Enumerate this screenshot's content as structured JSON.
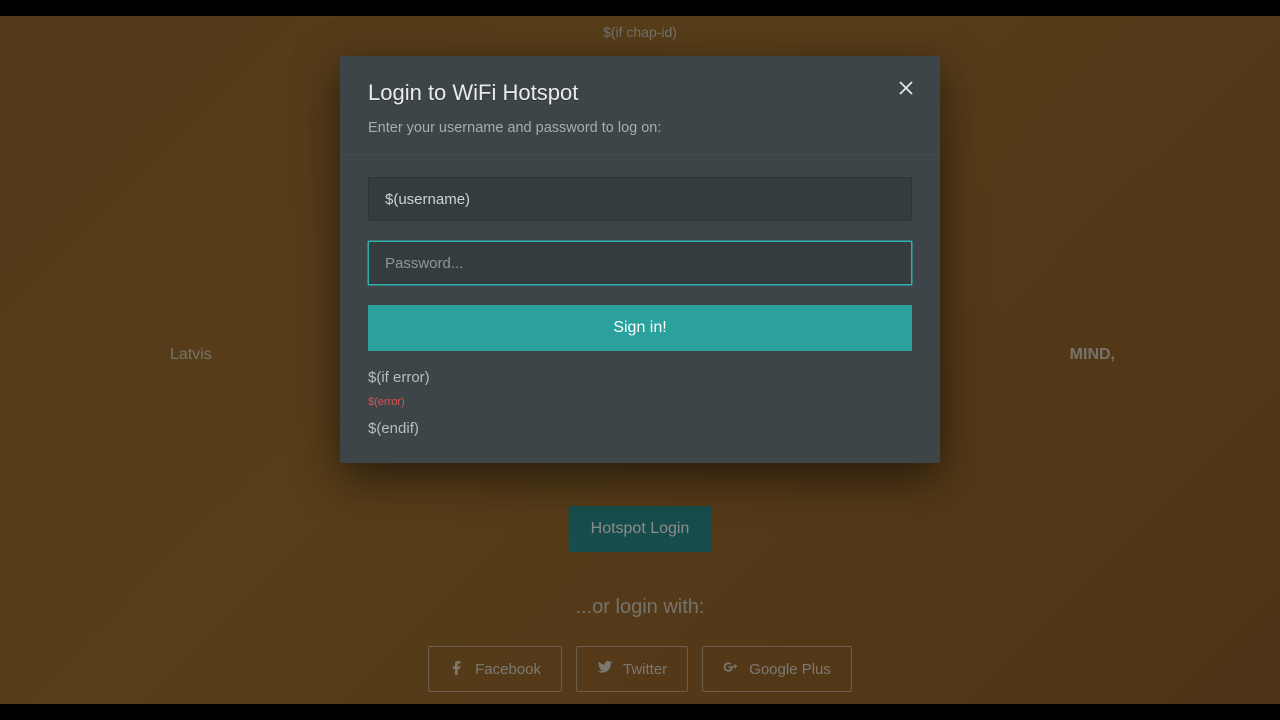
{
  "background": {
    "chap_id": "$(if chap-id)",
    "mid_left": "Latvis",
    "mid_right": "MIND,",
    "hotspot_button": "Hotspot Login",
    "or_login": "...or login with:",
    "social": {
      "facebook": "Facebook",
      "twitter": "Twitter",
      "googleplus": "Google Plus"
    }
  },
  "modal": {
    "title": "Login to WiFi Hotspot",
    "subtitle": "Enter your username and password to log on:",
    "username_value": "$(username)",
    "password_placeholder": "Password...",
    "signin_label": "Sign in!",
    "if_error": "$(if error)",
    "error_token": "$(error)",
    "endif": "$(endif)"
  },
  "colors": {
    "accent": "#2aa19c",
    "modal_bg": "#3d4549",
    "error": "#d9534f"
  }
}
